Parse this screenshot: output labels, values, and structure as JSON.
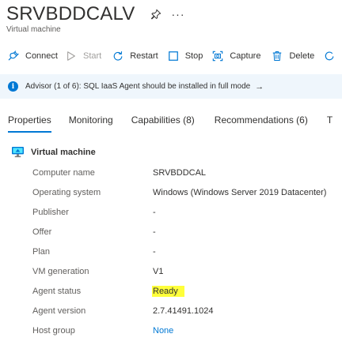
{
  "header": {
    "title": "SRVBDDCALV",
    "subtitle": "Virtual machine",
    "more": "···"
  },
  "toolbar": {
    "connect": "Connect",
    "start": "Start",
    "restart": "Restart",
    "stop": "Stop",
    "capture": "Capture",
    "delete": "Delete"
  },
  "banner": {
    "text": "Advisor (1 of 6): SQL IaaS Agent should be installed in full mode",
    "arrow": "→",
    "icon": "i"
  },
  "tabs": [
    {
      "label": "Properties",
      "active": true
    },
    {
      "label": "Monitoring",
      "active": false
    },
    {
      "label": "Capabilities (8)",
      "active": false
    },
    {
      "label": "Recommendations (6)",
      "active": false
    },
    {
      "label": "T",
      "active": false
    }
  ],
  "section": {
    "title": "Virtual machine",
    "rows": [
      {
        "key": "Computer name",
        "value": "SRVBDDCAL"
      },
      {
        "key": "Operating system",
        "value": "Windows (Windows Server 2019 Datacenter)"
      },
      {
        "key": "Publisher",
        "value": "-"
      },
      {
        "key": "Offer",
        "value": "-"
      },
      {
        "key": "Plan",
        "value": "-"
      },
      {
        "key": "VM generation",
        "value": "V1"
      },
      {
        "key": "Agent status",
        "value": "Ready"
      },
      {
        "key": "Agent version",
        "value": "2.7.41491.1024"
      },
      {
        "key": "Host group",
        "value": "None"
      }
    ]
  },
  "colors": {
    "accent": "#0078d4",
    "banner_bg": "#eff6fc",
    "highlight": "#ffff3a"
  }
}
